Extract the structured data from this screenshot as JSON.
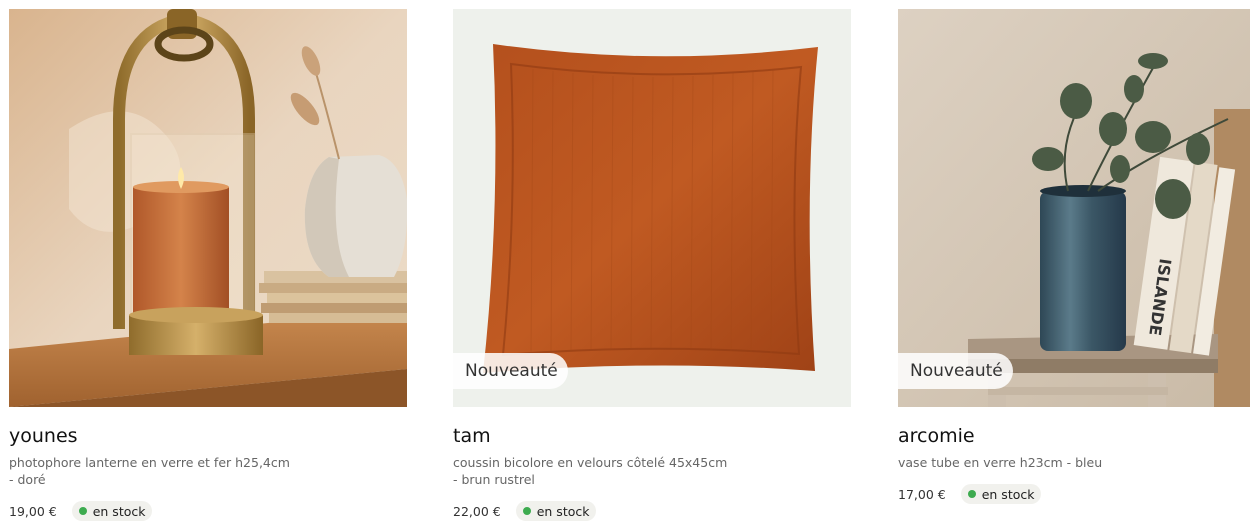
{
  "products": [
    {
      "name": "younes",
      "description": "photophore lanterne en verre et fer h25,4cm - doré",
      "price": "19,00 €",
      "stock": "en stock",
      "badge": ""
    },
    {
      "name": "tam",
      "description": "coussin bicolore en velours côtelé 45x45cm - brun rustrel",
      "price": "22,00 €",
      "stock": "en stock",
      "badge": "Nouveauté"
    },
    {
      "name": "arcomie",
      "description": "vase tube en verre h23cm - bleu",
      "price": "17,00 €",
      "stock": "en stock",
      "badge": "Nouveauté",
      "book_spine_text": "ISLANDE"
    }
  ],
  "colors": {
    "stock_dot": "#3dab4f",
    "cushion": "#b04e1c",
    "vase": "#3b5766"
  }
}
